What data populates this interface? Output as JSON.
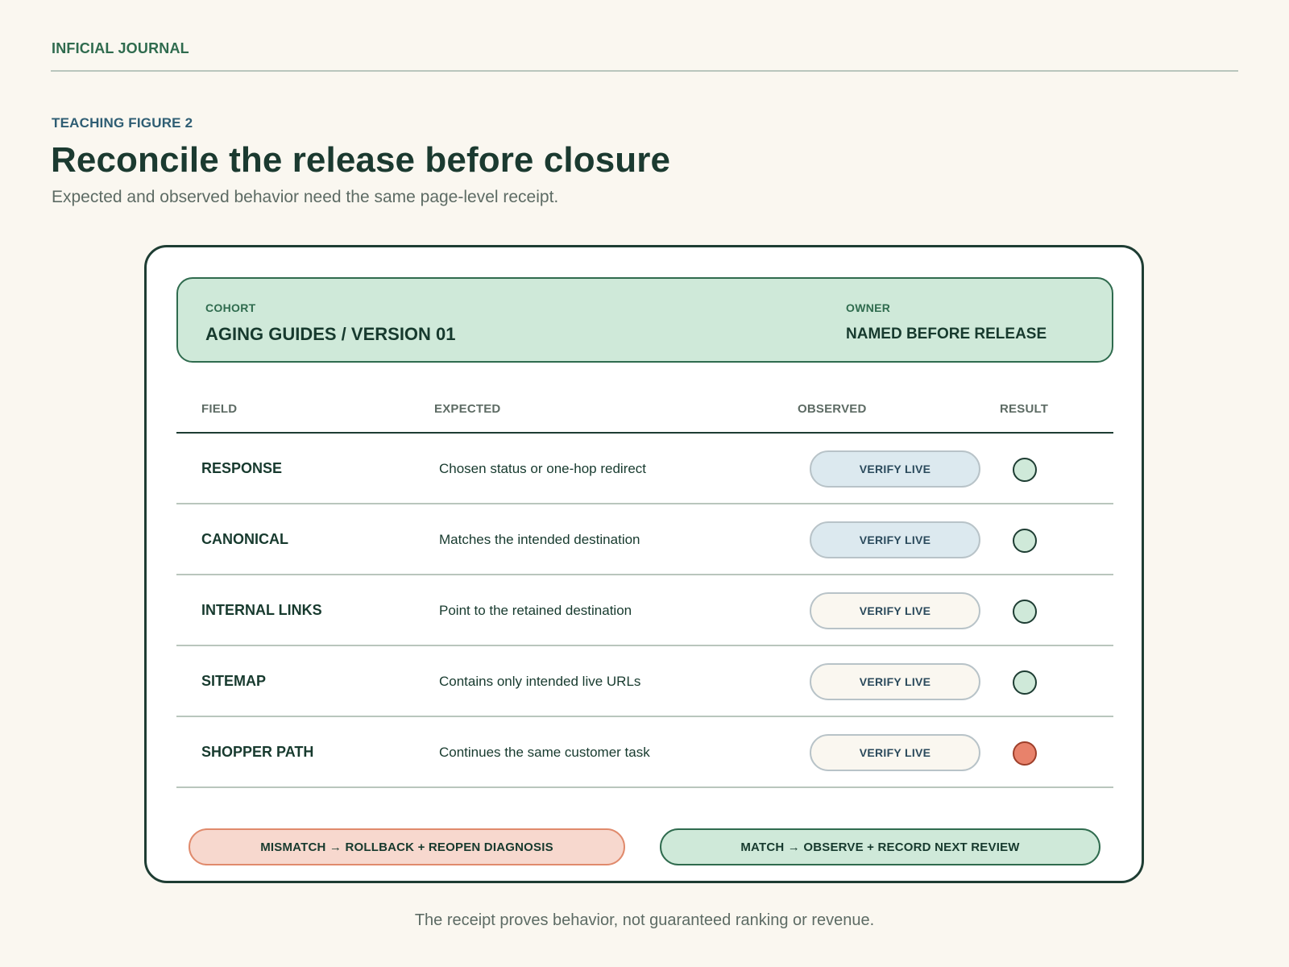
{
  "journal": "INFICIAL JOURNAL",
  "kicker": "TEACHING FIGURE 2",
  "title": "Reconcile the release before closure",
  "subtitle": "Expected and observed behavior need the same page-level receipt.",
  "header": {
    "cohort_label": "COHORT",
    "cohort_value": "AGING GUIDES / VERSION 01",
    "owner_label": "OWNER",
    "owner_value": "NAMED BEFORE RELEASE"
  },
  "columns": {
    "field": "FIELD",
    "expected": "EXPECTED",
    "observed": "OBSERVED",
    "result": "RESULT"
  },
  "rows": [
    {
      "field": "RESPONSE",
      "expected": "Chosen status or one-hop redirect",
      "observed": "VERIFY LIVE",
      "pill_style": "blue",
      "result": "match"
    },
    {
      "field": "CANONICAL",
      "expected": "Matches the intended destination",
      "observed": "VERIFY LIVE",
      "pill_style": "blue",
      "result": "match"
    },
    {
      "field": "INTERNAL LINKS",
      "expected": "Point to the retained destination",
      "observed": "VERIFY LIVE",
      "pill_style": "cream",
      "result": "match"
    },
    {
      "field": "SITEMAP",
      "expected": "Contains only intended live URLs",
      "observed": "VERIFY LIVE",
      "pill_style": "cream",
      "result": "match"
    },
    {
      "field": "SHOPPER PATH",
      "expected": "Continues the same customer task",
      "observed": "VERIFY LIVE",
      "pill_style": "cream",
      "result": "mismatch"
    }
  ],
  "result_colors": {
    "match": "#cfe9d9",
    "mismatch": "#e8826b"
  },
  "footer": {
    "mismatch_label": "MISMATCH → ROLLBACK + REOPEN DIAGNOSIS",
    "match_label": "MATCH → OBSERVE + RECORD NEXT REVIEW"
  },
  "caption": "The receipt proves behavior, not guaranteed ranking or revenue."
}
